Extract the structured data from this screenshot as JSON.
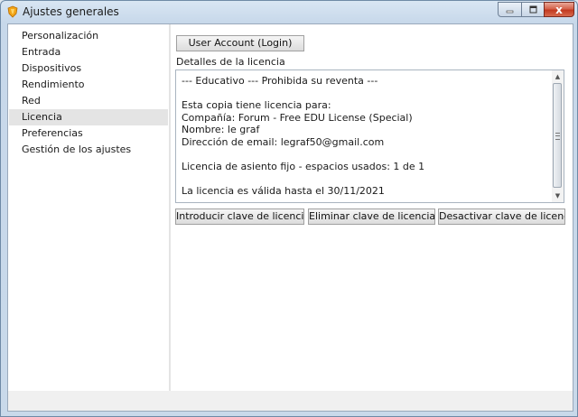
{
  "window": {
    "title": "Ajustes generales",
    "icons": {
      "app": "app-logo-icon",
      "minimize": "minimize-icon",
      "maximize": "maximize-icon",
      "close": "close-icon"
    },
    "close_glyph": "x"
  },
  "sidebar": {
    "items": [
      {
        "label": "Personalización"
      },
      {
        "label": "Entrada"
      },
      {
        "label": "Dispositivos"
      },
      {
        "label": "Rendimiento"
      },
      {
        "label": "Red"
      },
      {
        "label": "Licencia",
        "selected": true
      },
      {
        "label": "Preferencias"
      },
      {
        "label": "Gestión de los ajustes"
      }
    ]
  },
  "license": {
    "account_button": "User Account (Login)",
    "details_label": "Detalles de la licencia",
    "lines": [
      "--- Educativo --- Prohibida su reventa ---",
      "",
      "Esta copia tiene licencia para:",
      "Compañía: Forum - Free EDU License (Special)",
      "Nombre: le graf",
      "Dirección de email: legraf50@gmail.com",
      "",
      "Licencia de asiento fijo - espacios usados: 1 de 1",
      "",
      "La licencia es válida hasta el 30/11/2021"
    ],
    "buttons": {
      "enter_key": "Introducir clave de licencia",
      "remove_key": "Eliminar clave de licencia",
      "deactivate_key": "Desactivar clave de licencia"
    }
  },
  "colors": {
    "selected_item_bg": "#e4e4e4",
    "title_bar": "#c7d8ea",
    "close_button": "#c23a20"
  }
}
